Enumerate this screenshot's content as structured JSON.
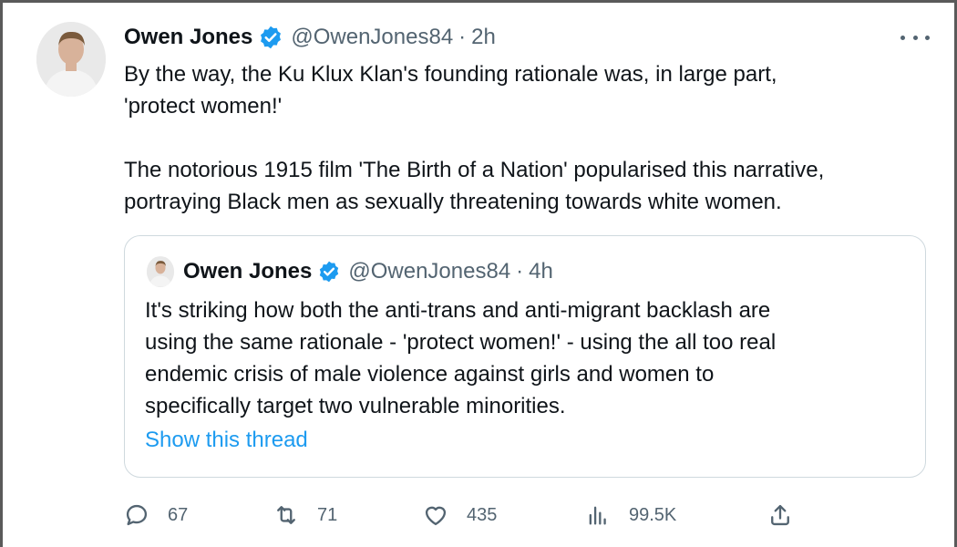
{
  "tweet": {
    "author_name": "Owen Jones",
    "handle": "@OwenJones84",
    "separator": "·",
    "time": "2h",
    "lines": [
      "By the way, the Ku Klux Klan's founding rationale was, in large part,",
      "'protect women!'",
      "The notorious 1915 film 'The Birth of a Nation' popularised this narrative,",
      "portraying Black men as sexually threatening towards white women."
    ]
  },
  "quote": {
    "author_name": "Owen Jones",
    "handle": "@OwenJones84",
    "separator": "·",
    "time": "4h",
    "lines": [
      "It's striking how both the anti-trans and anti-migrant backlash are",
      "using the same rationale - 'protect women!' - using the all too real",
      "endemic crisis of male violence against girls and women to",
      "specifically target two vulnerable minorities."
    ],
    "show_thread": "Show this thread"
  },
  "actions": {
    "replies": "67",
    "retweets": "71",
    "likes": "435",
    "views": "99.5K"
  },
  "icons": {
    "verified": "verified-badge-icon",
    "more": "more-icon",
    "reply": "reply-icon",
    "retweet": "retweet-icon",
    "like": "heart-icon",
    "views": "views-icon",
    "share": "share-icon"
  },
  "colors": {
    "text": "#0f1419",
    "secondary": "#536471",
    "link": "#1d9bf0",
    "verified": "#1d9bf0",
    "border": "#cfd9de"
  }
}
